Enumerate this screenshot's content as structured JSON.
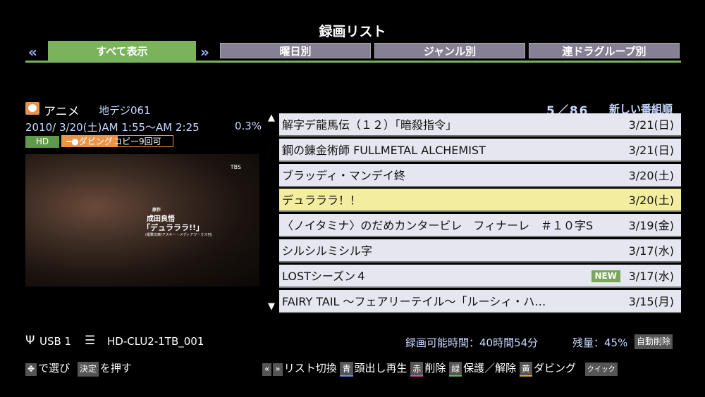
{
  "header": {
    "title": "録画リスト"
  },
  "tabs": [
    {
      "label": "すべて表示",
      "active": true
    },
    {
      "label": "曜日別"
    },
    {
      "label": "ジャンル別"
    },
    {
      "label": "連ドラグループ別"
    }
  ],
  "info": {
    "genre": "アニメ",
    "channel": "地デジ061",
    "datetime": "2010/ 3/20(土)AM 1:55～AM 2:25",
    "percent": "0.3%",
    "hd": "HD",
    "dubbing": "ダビング",
    "copy": "コピー9回可"
  },
  "video_overlay": {
    "role": "原作",
    "author": "成田良悟",
    "work": "「デュラララ!!」",
    "publisher": "(電撃文庫/アスキー・メディアワークス刊)",
    "station_logo": "TBS"
  },
  "list": {
    "position": "5／86",
    "sort": "新しい番組順",
    "items": [
      {
        "title": "解字デ龍馬伝（１２）「暗殺指令」",
        "date": "3/21(日)"
      },
      {
        "title": "鋼の錬金術師 FULLMETAL ALCHEMIST",
        "date": "3/21(日)"
      },
      {
        "title": "ブラッディ・マンデイ終",
        "date": "3/20(土)"
      },
      {
        "title": "デュラララ！！",
        "date": "3/20(土)",
        "selected": true
      },
      {
        "title": "〈ノイタミナ〉のだめカンタービレ　フィナーレ　＃１０字S",
        "date": "3/19(金)"
      },
      {
        "title": "シルシルミシル字",
        "date": "3/17(水)"
      },
      {
        "title": "LOSTシーズン４",
        "date": "3/17(水)",
        "badge": "NEW"
      },
      {
        "title": "FAIRY TAIL ～フェアリーテイル～「ルーシィ・ハ…",
        "date": "3/15(月)"
      }
    ]
  },
  "status": {
    "device": "USB 1",
    "drive": "HD-CLU2-1TB_001",
    "rec_time": "録画可能時間：40時間54分",
    "remain": "残量：45%",
    "auto_delete": "自動削除"
  },
  "footer": {
    "select": "で選び",
    "enter_key": "決定",
    "press": "を押す",
    "list_switch": "リスト切換",
    "blue_key": "青",
    "blue": "頭出し再生",
    "red_key": "赤",
    "red": "削除",
    "green_key": "緑",
    "green": "保護／解除",
    "yellow_key": "黄",
    "yellow": "ダビング",
    "quick": "クイック"
  },
  "colors": {
    "accent": "#7ab35b",
    "selected_row": "#f3eda0",
    "text_blue": "#c8d8ff"
  }
}
